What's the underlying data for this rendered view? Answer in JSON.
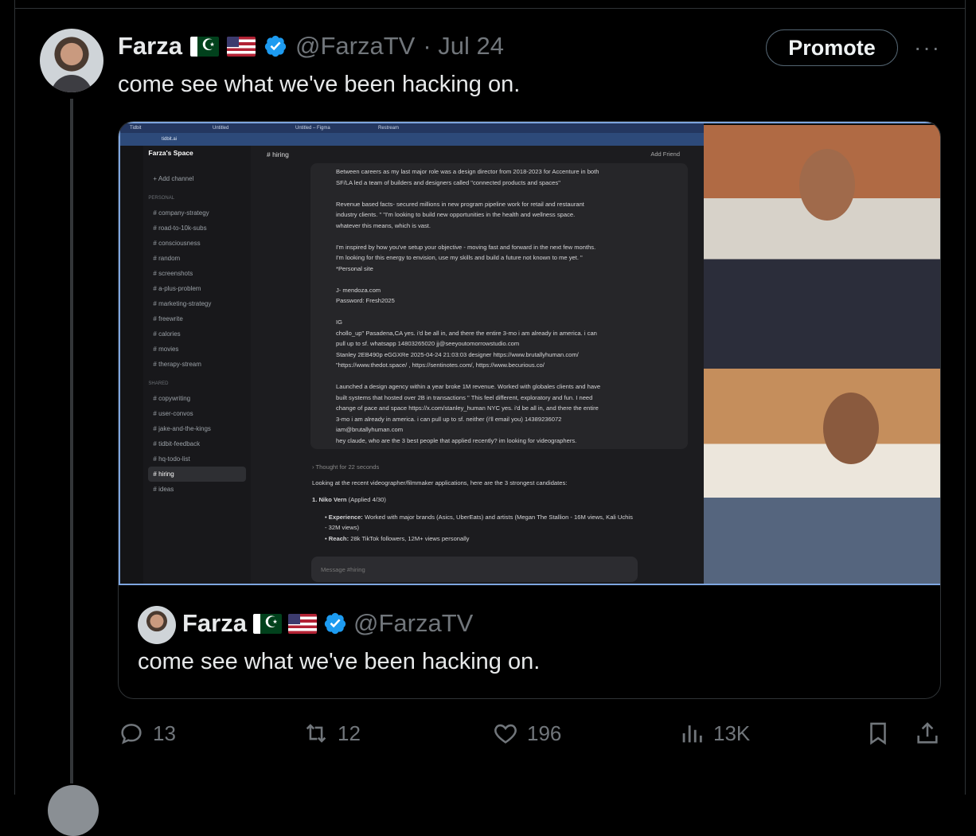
{
  "tweet": {
    "author_name": "Farza",
    "flags": [
      "pakistan-flag",
      "usa-flag"
    ],
    "handle": "@FarzaTV",
    "date": "· Jul 24",
    "text": "come see what we've been hacking on.",
    "promote_label": "Promote",
    "more_label": "···"
  },
  "embedded_video": {
    "tabs": [
      "Tidbit",
      "Untitled",
      "Untitled – Figma",
      "Restream"
    ],
    "url": "tidbit.ai",
    "space_name": "Farza's Space",
    "add_channel": "Add channel",
    "personal_label": "PERSONAL",
    "personal_channels": [
      "company-strategy",
      "road-to-10k-subs",
      "consciousness",
      "random",
      "screenshots",
      "a-plus-problem",
      "marketing-strategy",
      "freewrite",
      "calories",
      "movies",
      "therapy-stream"
    ],
    "shared_label": "SHARED",
    "shared_channels": [
      "copywriting",
      "user-convos",
      "jake-and-the-kings",
      "tidbit-feedback",
      "hq-todo-list",
      "hiring",
      "ideas"
    ],
    "channel_title": "# hiring",
    "add_friend": "Add Friend",
    "message_lines": [
      "Between careers as my last major role was a design director from 2018-2023 for Accenture in both",
      "SF/LA led a team of builders and designers called \"connected products and spaces\"",
      "",
      "Revenue based facts- secured millions in new program pipeline work for retail and restaurant",
      "industry clients. \" \"I'm looking to build new opportunities in the health and wellness space.",
      "whatever this means, which is vast.",
      "",
      "I'm inspired by how you've setup your objective - moving fast and forward in the next few months.",
      "I'm looking for this energy to envision, use my skills and build a future not known to me yet. \"",
      "*Personal site",
      "",
      "J- mendoza.com",
      "Password: Fresh2025",
      "",
      "IG",
      "chollo_up\" Pasadena,CA yes. i'd be all in, and there the entire 3-mo i am already in america. i can",
      "pull up to sf. whatsapp 14803265020 jj@seeyoutomorrowstudio.com",
      "Stanley 2EB490p eGGXRe 2025-04-24 21:03:03 designer https://www.brutallyhuman.com/",
      "\"https://www.thedot.space/ , https://sentinotes.com/, https://www.becurious.co/",
      "",
      "Launched a design agency within a year broke 1M revenue. Worked with globales clients and have",
      "built systems that hosted over 2B in transactions \" This feel different, exploratory and fun. I need",
      "change of pace and space https://x.com/stanley_human NYC yes. i'd be all in, and there the entire",
      "3-mo i am already in america. i can pull up to sf. neither (i'll email you) 14389236072",
      "iam@brutallyhuman.com",
      "hey claude, who are the 3 best people that applied recently? im looking for videographers."
    ],
    "thought": "Thought for 22 seconds",
    "reply_intro": "Looking at the recent videographer/filmmaker applications, here are the 3 strongest candidates:",
    "candidate_title": "1. Niko Vern",
    "candidate_applied": "(Applied 4/30)",
    "experience_label": "Experience:",
    "experience_text": "Worked with major brands (Asics, UberEats) and artists (Megan The Stallion - 16M views, Kali Uchis - 32M views)",
    "reach_label": "Reach:",
    "reach_text": "28k TikTok followers, 12M+ views personally",
    "input_placeholder": "Message #hiring"
  },
  "quoted_tweet": {
    "author_name": "Farza",
    "handle": "@FarzaTV",
    "text": "come see what we've been hacking on."
  },
  "actions": {
    "replies": "13",
    "reposts": "12",
    "likes": "196",
    "views": "13K"
  },
  "colors": {
    "verified_blue": "#1d9bf0",
    "muted": "#71767b",
    "border": "#2f3336"
  }
}
